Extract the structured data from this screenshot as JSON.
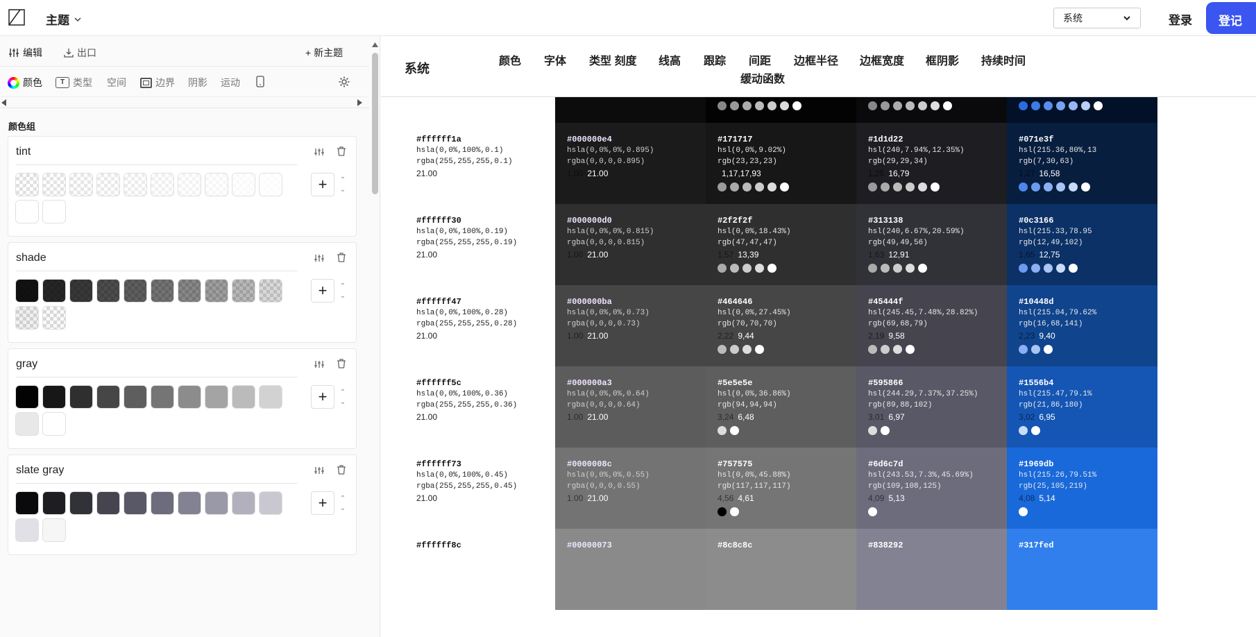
{
  "topbar": {
    "app_title": "主题",
    "system_select_value": "系统",
    "login_label": "登录",
    "register_label": "登记"
  },
  "toolbar": {
    "edit_label": "编辑",
    "export_label": "出口",
    "new_theme_label": "+ 新主题"
  },
  "tabs": [
    {
      "label": "颜色",
      "icon": "color-wheel-icon"
    },
    {
      "label": "类型",
      "icon": "type-icon"
    },
    {
      "label": "空间",
      "icon": ""
    },
    {
      "label": "边界",
      "icon": "border-icon"
    },
    {
      "label": "阴影",
      "icon": ""
    },
    {
      "label": "运动",
      "icon": ""
    }
  ],
  "color_groups_title": "颜色组",
  "color_groups": [
    {
      "name": "tint",
      "swatches": [
        "rgba(255,255,255,0.1)",
        "rgba(255,255,255,0.19)",
        "rgba(255,255,255,0.28)",
        "rgba(255,255,255,0.36)",
        "rgba(255,255,255,0.45)",
        "rgba(255,255,255,0.55)",
        "rgba(255,255,255,0.64)",
        "rgba(255,255,255,0.73)",
        "rgba(255,255,255,0.82)",
        "rgba(255,255,255,0.9)",
        "rgba(255,255,255,0.95)",
        "#ffffff"
      ]
    },
    {
      "name": "shade",
      "swatches": [
        "rgba(0,0,0,0.93)",
        "rgba(0,0,0,0.85)",
        "rgba(0,0,0,0.78)",
        "rgba(0,0,0,0.7)",
        "rgba(0,0,0,0.63)",
        "rgba(0,0,0,0.55)",
        "rgba(0,0,0,0.47)",
        "rgba(0,0,0,0.38)",
        "rgba(0,0,0,0.28)",
        "rgba(0,0,0,0.15)",
        "rgba(0,0,0,0.06)",
        "rgba(0,0,0,0.02)"
      ]
    },
    {
      "name": "gray",
      "swatches": [
        "#030303",
        "#171717",
        "#2f2f2f",
        "#464646",
        "#5e5e5e",
        "#757575",
        "#8c8c8c",
        "#a4a4a4",
        "#bbbbbb",
        "#d2d2d2",
        "#e8e8e8",
        "#ffffff"
      ]
    },
    {
      "name": "slate gray",
      "swatches": [
        "#0a0a0c",
        "#1d1d22",
        "#313138",
        "#45444f",
        "#595866",
        "#6d6c7d",
        "#838292",
        "#9999a7",
        "#b1b0bc",
        "#c9c8d1",
        "#e1e0e6",
        "#f6f6f7"
      ]
    }
  ],
  "header": {
    "section_title": "系统",
    "nav": [
      "颜色",
      "字体",
      "类型 刻度",
      "线高",
      "跟踪",
      "间距",
      "边框半径",
      "边框宽度",
      "框阴影",
      "持续时间",
      "缓动函数"
    ]
  },
  "grid_top_partial": [
    {
      "bg": "#0c0c0c",
      "dots": []
    },
    {
      "bg": "#030303",
      "dots": [
        "#888888",
        "#999999",
        "#aaaaaa",
        "#bbbbbb",
        "#cccccc",
        "#dddddd",
        "#ffffff"
      ]
    },
    {
      "bg": "#0a0a0c",
      "dots": [
        "#888888",
        "#999999",
        "#aaaaaa",
        "#bbbbbb",
        "#cccccc",
        "#dddddd",
        "#ffffff"
      ]
    },
    {
      "bg": "#021127",
      "dots": [
        "#2a6ce0",
        "#3f7ae6",
        "#5a8def",
        "#78a2f2",
        "#97b8f5",
        "#b9cff8",
        "#ffffff"
      ]
    }
  ],
  "rows": [
    {
      "tint": {
        "hex": "#ffffff1a",
        "l1": "hsla(0,0%,100%,0.1)",
        "l2": "rgba(255,255,255,0.1)",
        "l3": "21.00"
      },
      "shade": {
        "bg": "#1b1b1b",
        "hex": "#000000e4",
        "l1": "hsla(0,0%,0%,0.895)",
        "l2": "rgba(0,0,0,0.895)",
        "a": "1.00",
        "b": "21.00"
      },
      "gray": {
        "bg": "#171717",
        "hex": "#171717",
        "l1": "hsl(0,0%,9.02%)",
        "l2": "rgb(23,23,23)",
        "a": "",
        "b": "1,17,17,93",
        "dots": [
          "#9a9a9a",
          "#aaaaaa",
          "#bbbbbb",
          "#cccccc",
          "#dddddd",
          "#ffffff"
        ]
      },
      "slate": {
        "bg": "#1d1d22",
        "hex": "#1d1d22",
        "l1": "hsl(240,7.94%,12.35%)",
        "l2": "rgb(29,29,34)",
        "a": "1,25",
        "b": "16,79",
        "dots": [
          "#9a9a9a",
          "#aaaaaa",
          "#bbbbbb",
          "#cccccc",
          "#dddddd",
          "#ffffff"
        ]
      },
      "blue": {
        "bg": "#071e3f",
        "hex": "#071e3f",
        "l1": "hsl(215.36,80%,13",
        "l2": "rgb(7,30,63)",
        "a": "1,27",
        "b": "16,58",
        "dots": [
          "#4d86ec",
          "#6a9bf0",
          "#8ab0f3",
          "#a9c5f6",
          "#c9dbf9",
          "#ffffff"
        ]
      }
    },
    {
      "tint": {
        "hex": "#ffffff30",
        "l1": "hsla(0,0%,100%,0.19)",
        "l2": "rgba(255,255,255,0.19)",
        "l3": "21.00"
      },
      "shade": {
        "bg": "#2f2f2f",
        "hex": "#000000d0",
        "l1": "hsla(0,0%,0%,0.815)",
        "l2": "rgba(0,0,0,0.815)",
        "a": "1.00",
        "b": "21.00"
      },
      "gray": {
        "bg": "#2f2f2f",
        "hex": "#2f2f2f",
        "l1": "hsl(0,0%,18.43%)",
        "l2": "rgb(47,47,47)",
        "a": "1,57",
        "b": "13,39",
        "dots": [
          "#aaaaaa",
          "#bbbbbb",
          "#cccccc",
          "#dddddd",
          "#ffffff"
        ]
      },
      "slate": {
        "bg": "#313138",
        "hex": "#313138",
        "l1": "hsl(240,6.67%,20.59%)",
        "l2": "rgb(49,49,56)",
        "a": "1,63",
        "b": "12,91",
        "dots": [
          "#aaaaaa",
          "#bbbbbb",
          "#cccccc",
          "#dddddd",
          "#ffffff"
        ]
      },
      "blue": {
        "bg": "#0c3166",
        "hex": "#0c3166",
        "l1": "hsl(215.33,78.95",
        "l2": "rgb(12,49,102)",
        "a": "1,65",
        "b": "12,75",
        "dots": [
          "#6a9bf0",
          "#8ab0f3",
          "#a9c5f6",
          "#c9dbf9",
          "#ffffff"
        ]
      }
    },
    {
      "tint": {
        "hex": "#ffffff47",
        "l1": "hsla(0,0%,100%,0.28)",
        "l2": "rgba(255,255,255,0.28)",
        "l3": "21.00"
      },
      "shade": {
        "bg": "#464646",
        "hex": "#000000ba",
        "l1": "hsla(0,0%,0%,0.73)",
        "l2": "rgba(0,0,0,0.73)",
        "a": "1.00",
        "b": "21.00"
      },
      "gray": {
        "bg": "#464646",
        "hex": "#464646",
        "l1": "hsl(0,0%,27.45%)",
        "l2": "rgb(70,70,70)",
        "a": "2,22",
        "b": "9,44",
        "dots": [
          "#bbbbbb",
          "#cccccc",
          "#dddddd",
          "#ffffff"
        ]
      },
      "slate": {
        "bg": "#45444f",
        "hex": "#45444f",
        "l1": "hsl(245.45,7.48%,28.82%)",
        "l2": "rgb(69,68,79)",
        "a": "2,19",
        "b": "9,58",
        "dots": [
          "#bbbbbb",
          "#cccccc",
          "#dddddd",
          "#ffffff"
        ]
      },
      "blue": {
        "bg": "#10448d",
        "hex": "#10448d",
        "l1": "hsl(215.04,79.62%",
        "l2": "rgb(16,68,141)",
        "a": "2,23",
        "b": "9,40",
        "dots": [
          "#8ab0f3",
          "#a9c5f6",
          "#ffffff"
        ]
      }
    },
    {
      "tint": {
        "hex": "#ffffff5c",
        "l1": "hsla(0,0%,100%,0.36)",
        "l2": "rgba(255,255,255,0.36)",
        "l3": "21.00"
      },
      "shade": {
        "bg": "#5c5c5c",
        "hex": "#000000a3",
        "l1": "hsla(0,0%,0%,0.64)",
        "l2": "rgba(0,0,0,0.64)",
        "a": "1.00",
        "b": "21.00"
      },
      "gray": {
        "bg": "#5e5e5e",
        "hex": "#5e5e5e",
        "l1": "hsl(0,0%,36.86%)",
        "l2": "rgb(94,94,94)",
        "a": "3,24",
        "b": "6,48",
        "dots": [
          "#dddddd",
          "#ffffff"
        ]
      },
      "slate": {
        "bg": "#595866",
        "hex": "#595866",
        "l1": "hsl(244.29,7.37%,37.25%)",
        "l2": "rgb(89,88,102)",
        "a": "3,01",
        "b": "6,97",
        "dots": [
          "#dddddd",
          "#ffffff"
        ]
      },
      "blue": {
        "bg": "#1556b4",
        "hex": "#1556b4",
        "l1": "hsl(215.47,79.1%",
        "l2": "rgb(21,86,180)",
        "a": "3,02",
        "b": "6,95",
        "dots": [
          "#c9dbf9",
          "#ffffff"
        ]
      }
    },
    {
      "tint": {
        "hex": "#ffffff73",
        "l1": "hsla(0,0%,100%,0.45)",
        "l2": "rgba(255,255,255,0.45)",
        "l3": "21.00"
      },
      "shade": {
        "bg": "#737373",
        "hex": "#0000008c",
        "l1": "hsla(0,0%,0%,0.55)",
        "l2": "rgba(0,0,0,0.55)",
        "a": "1.00",
        "b": "21.00"
      },
      "gray": {
        "bg": "#757575",
        "hex": "#757575",
        "l1": "hsl(0,0%,45.88%)",
        "l2": "rgb(117,117,117)",
        "a": "4,56",
        "b": "4,61",
        "dots": [
          "#000000",
          "#ffffff"
        ]
      },
      "slate": {
        "bg": "#6d6c7d",
        "hex": "#6d6c7d",
        "l1": "hsl(243.53,7.3%,45.69%)",
        "l2": "rgb(109,108,125)",
        "a": "4,09",
        "b": "5,13",
        "dots": [
          "#ffffff"
        ]
      },
      "blue": {
        "bg": "#1969db",
        "hex": "#1969db",
        "l1": "hsl(215.26,79.51%",
        "l2": "rgb(25,105,219)",
        "a": "4,08",
        "b": "5,14",
        "dots": [
          "#ffffff"
        ]
      }
    },
    {
      "tint": {
        "hex": "#ffffff8c",
        "l1": "",
        "l2": "",
        "l3": ""
      },
      "shade": {
        "bg": "#8a8a8a",
        "hex": "#00000073",
        "l1": "",
        "l2": "",
        "a": "",
        "b": ""
      },
      "gray": {
        "bg": "#8c8c8c",
        "hex": "#8c8c8c",
        "l1": "",
        "l2": "",
        "a": "",
        "b": "",
        "dots": []
      },
      "slate": {
        "bg": "#838292",
        "hex": "#838292",
        "l1": "",
        "l2": "",
        "a": "",
        "b": "",
        "dots": []
      },
      "blue": {
        "bg": "#317fed",
        "hex": "#317fed",
        "l1": "",
        "l2": "",
        "a": "",
        "b": "",
        "dots": []
      }
    }
  ]
}
